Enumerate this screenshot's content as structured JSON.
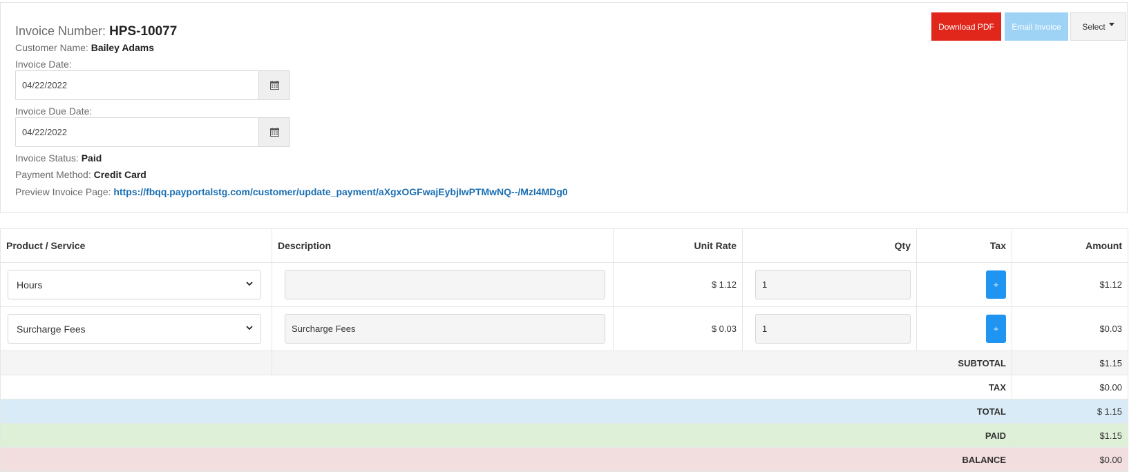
{
  "invoice": {
    "number_label": "Invoice Number:",
    "number": "HPS-10077",
    "customer_label": "Customer Name:",
    "customer": "Bailey Adams",
    "date_label": "Invoice Date:",
    "date": "04/22/2022",
    "due_label": "Invoice Due Date:",
    "due_date": "04/22/2022",
    "status_label": "Invoice Status:",
    "status": "Paid",
    "payment_label": "Payment Method:",
    "payment": "Credit Card",
    "preview_label": "Preview Invoice Page:",
    "preview_url": "https://fbqq.payportalstg.com/customer/update_payment/aXgxOGFwajEybjIwPTMwNQ--/MzI4MDg0"
  },
  "actions": {
    "download_pdf": "Download PDF",
    "email_invoice": "Email Invoice",
    "select": "Select"
  },
  "table": {
    "headers": {
      "product": "Product / Service",
      "description": "Description",
      "unit_rate": "Unit Rate",
      "qty": "Qty",
      "tax": "Tax",
      "amount": "Amount"
    },
    "rows": [
      {
        "product": "Hours",
        "description": "",
        "unit_rate": "$ 1.12",
        "qty": "1",
        "tax_button": "+",
        "amount": "$1.12"
      },
      {
        "product": "Surcharge Fees",
        "description": "Surcharge Fees",
        "unit_rate": "$ 0.03",
        "qty": "1",
        "tax_button": "+",
        "amount": "$0.03"
      }
    ],
    "summary": {
      "subtotal_label": "SUBTOTAL",
      "subtotal": "$1.15",
      "tax_label": "TAX",
      "tax": "$0.00",
      "total_label": "TOTAL",
      "total": "$ 1.15",
      "paid_label": "PAID",
      "paid": "$1.15",
      "balance_label": "BALANCE",
      "balance": "$0.00"
    }
  },
  "colors": {
    "download_pdf": "#e1261c",
    "email_invoice": "#9fd3f6",
    "tax_button": "#1f94f0",
    "link": "#1a6fb3",
    "total_row": "#d9ebf6",
    "paid_row": "#dff0d8",
    "balance_row": "#f2dede"
  },
  "icons": [
    "calendar-icon",
    "chevron-down-icon",
    "caret-down-icon"
  ]
}
